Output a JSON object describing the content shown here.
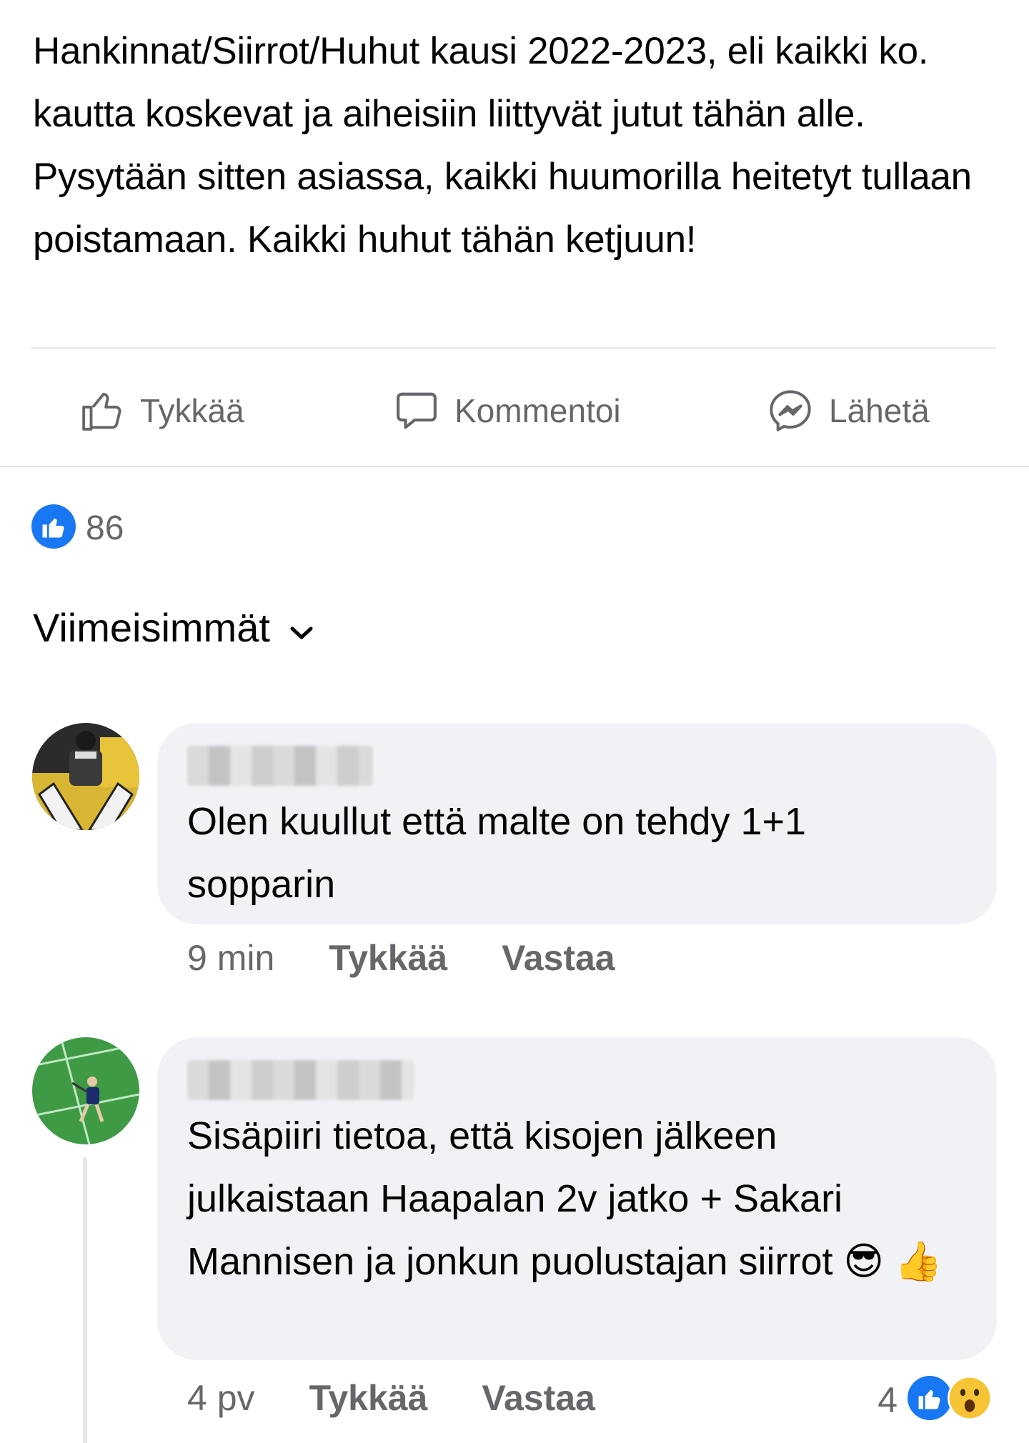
{
  "post": {
    "text": "Hankinnat/Siirrot/Huhut kausi 2022-2023, eli kaikki ko. kautta koskevat ja aiheisiin liittyvät jutut tähän alle. Pysytään sitten asiassa, kaikki huumorilla heitetyt tullaan poistamaan. Kaikki huhut tähän ketjuun!"
  },
  "actions": {
    "like": {
      "label": "Tykkää",
      "icon": "thumbs-up-outline-icon"
    },
    "comment": {
      "label": "Kommentoi",
      "icon": "speech-bubble-icon"
    },
    "send": {
      "label": "Lähetä",
      "icon": "messenger-icon"
    }
  },
  "reactions": {
    "count": "86",
    "icon": "like-reaction-icon",
    "color": "#1877f2"
  },
  "sort": {
    "label": "Viimeisimmät",
    "icon": "chevron-down-icon"
  },
  "comments": [
    {
      "avatar": "goalie-photo-avatar",
      "text": "Olen kuullut että malte on tehdy 1+1 sopparin",
      "time": "9 min",
      "like_label": "Tykkää",
      "reply_label": "Vastaa"
    },
    {
      "avatar": "floorball-player-avatar",
      "text": "Sisäpiiri tietoa, että kisojen jälkeen julkaistaan Haapalan 2v jatko + Sakari Mannisen ja jonkun puolustajan siirrot",
      "emoji_1": "😎",
      "emoji_2": "👍",
      "time": "4 pv",
      "like_label": "Tykkää",
      "reply_label": "Vastaa",
      "reaction_count": "4",
      "reaction_icons": [
        "like-reaction-icon",
        "wow-reaction-icon"
      ]
    }
  ]
}
